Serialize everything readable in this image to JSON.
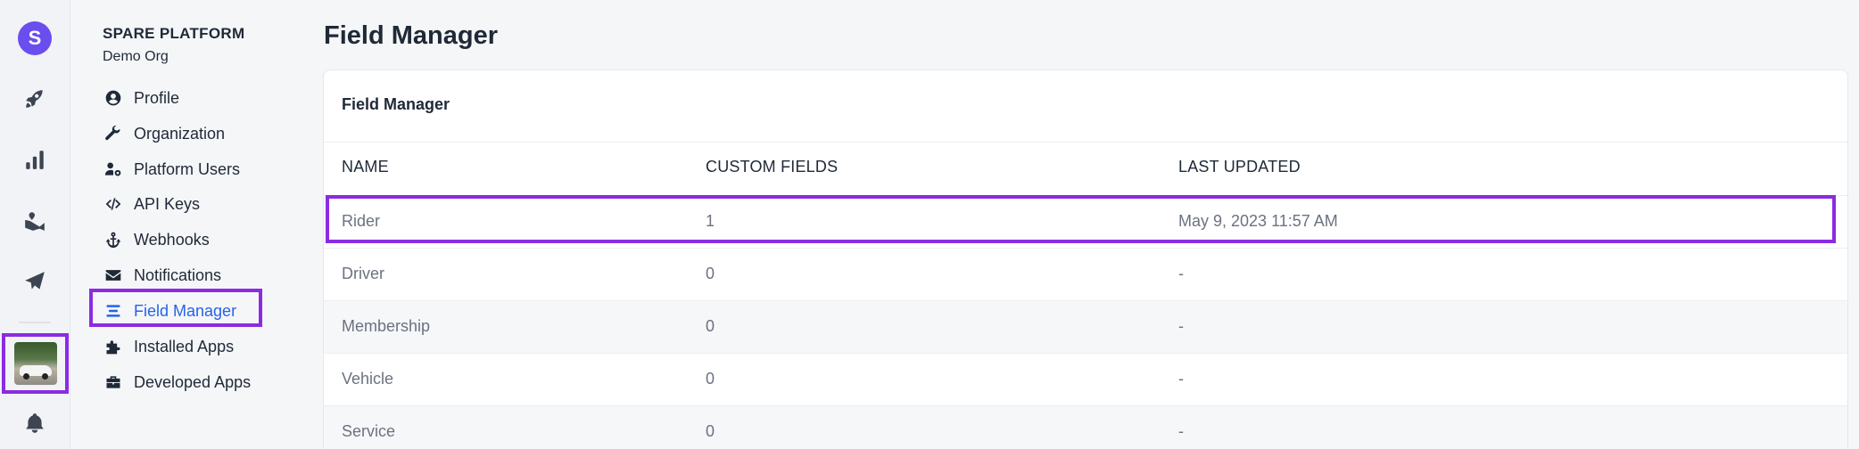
{
  "rail": {
    "logo_letter": "S",
    "icons": [
      "rocket-icon",
      "bar-chart-icon",
      "map-icon",
      "paper-plane-icon",
      "bell-icon"
    ]
  },
  "sidebar": {
    "org_title": "SPARE PLATFORM",
    "org_name": "Demo Org",
    "items": [
      {
        "label": "Profile",
        "icon": "user-circle-icon"
      },
      {
        "label": "Organization",
        "icon": "wrench-icon"
      },
      {
        "label": "Platform Users",
        "icon": "users-cog-icon"
      },
      {
        "label": "API Keys",
        "icon": "code-icon"
      },
      {
        "label": "Webhooks",
        "icon": "anchor-icon"
      },
      {
        "label": "Notifications",
        "icon": "envelope-icon"
      },
      {
        "label": "Field Manager",
        "icon": "list-icon",
        "active": true
      },
      {
        "label": "Installed Apps",
        "icon": "puzzle-icon"
      },
      {
        "label": "Developed Apps",
        "icon": "toolbox-icon"
      }
    ]
  },
  "main": {
    "page_title": "Field Manager",
    "card_title": "Field Manager",
    "columns": [
      "NAME",
      "CUSTOM FIELDS",
      "LAST UPDATED"
    ],
    "rows": [
      {
        "name": "Rider",
        "custom_fields": "1",
        "last_updated": "May 9, 2023 11:57 AM"
      },
      {
        "name": "Driver",
        "custom_fields": "0",
        "last_updated": "-"
      },
      {
        "name": "Membership",
        "custom_fields": "0",
        "last_updated": "-"
      },
      {
        "name": "Vehicle",
        "custom_fields": "0",
        "last_updated": "-"
      },
      {
        "name": "Service",
        "custom_fields": "0",
        "last_updated": "-"
      }
    ]
  },
  "colors": {
    "accent": "#2563eb",
    "highlight": "#8b2be2",
    "logo": "#6a4ef0"
  }
}
